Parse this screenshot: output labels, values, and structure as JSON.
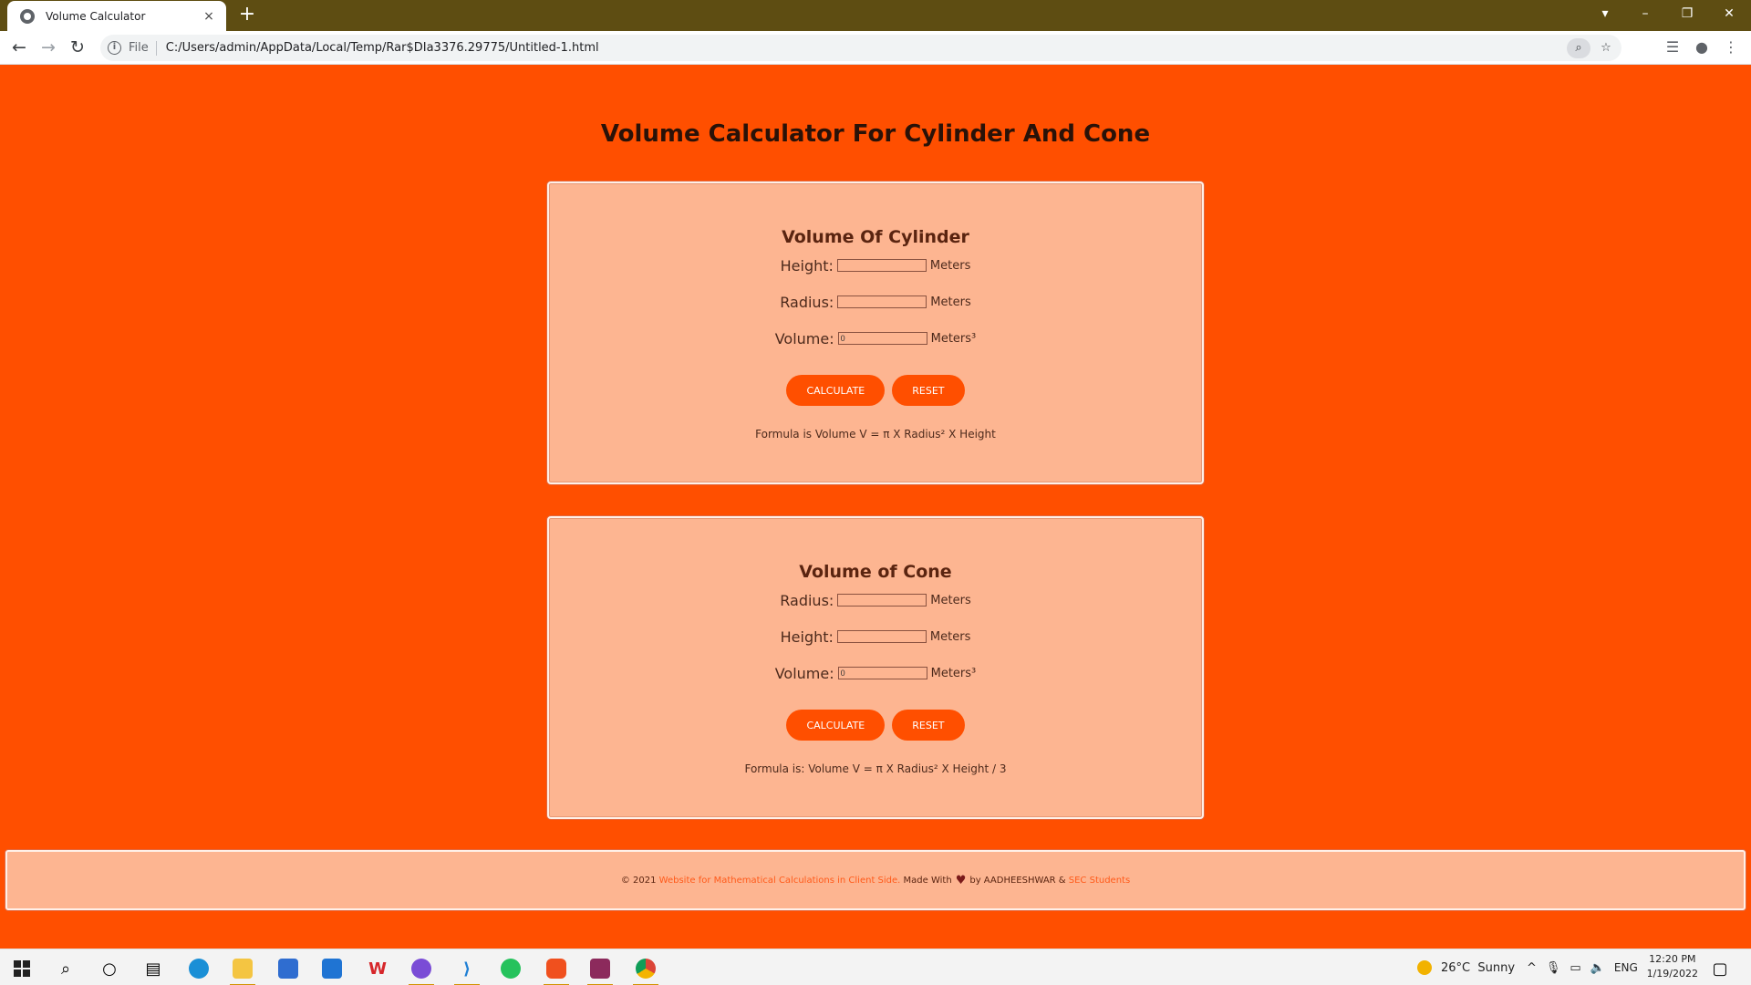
{
  "browser": {
    "tab_title": "Volume Calculator",
    "tab_close": "×",
    "new_tab": "+",
    "scheme_label": "File",
    "url": "C:/Users/admin/AppData/Local/Temp/Rar$DIa3376.29775/Untitled-1.html"
  },
  "page": {
    "title": "Volume Calculator For Cylinder And Cone"
  },
  "cylinder": {
    "heading": "Volume Of Cylinder",
    "height_label": "Height:",
    "radius_label": "Radius:",
    "volume_label": "Volume:",
    "unit": "Meters",
    "volume_unit": "Meters³",
    "volume_value": "0",
    "calculate_label": "CALCULATE",
    "reset_label": "RESET",
    "formula": "Formula is Volume V = π X Radius² X Height"
  },
  "cone": {
    "heading": "Volume of Cone",
    "radius_label": "Radius:",
    "height_label": "Height:",
    "volume_label": "Volume:",
    "unit": "Meters",
    "volume_unit": "Meters³",
    "volume_value": "0",
    "calculate_label": "CALCULATE",
    "reset_label": "RESET",
    "formula": "Formula is: Volume V = π X Radius² X Height / 3"
  },
  "footer": {
    "copyright": "© 2021",
    "site_link": "Website for Mathematical Calculations in Client Side.",
    "made_with": "Made With",
    "heart": "♥",
    "by": "by AADHEESHWAR &",
    "org_link": "SEC Students"
  },
  "taskbar": {
    "temperature": "26°C",
    "weather": "Sunny",
    "language": "ENG",
    "time": "12:20 PM",
    "date": "1/19/2022"
  },
  "colors": {
    "page_bg": "#ff4f00",
    "card_bg": "#fdb591",
    "title_bar": "#5e4d12",
    "button": "#ff4f00"
  }
}
